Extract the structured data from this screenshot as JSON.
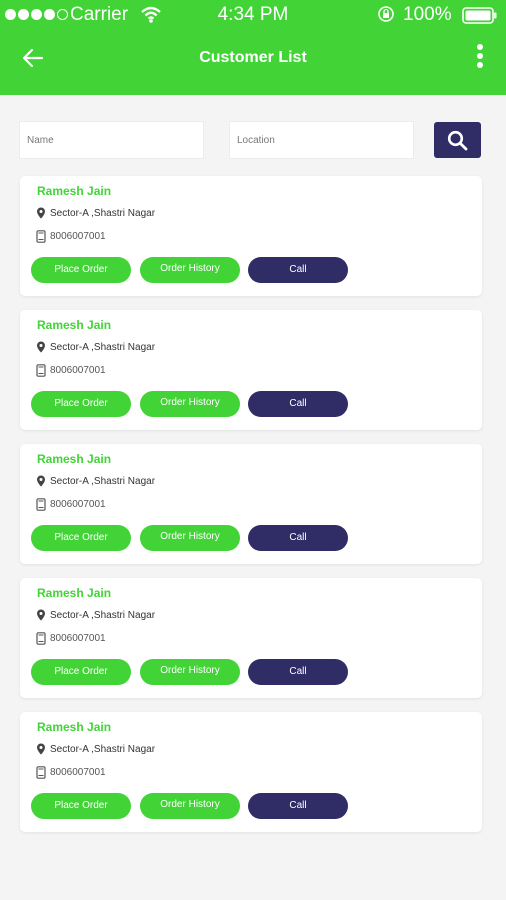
{
  "status_bar": {
    "carrier": "Carrier",
    "time": "4:34 PM",
    "battery": "100%"
  },
  "header": {
    "title": "Customer List"
  },
  "search": {
    "name_placeholder": "Name",
    "location_placeholder": "Location"
  },
  "customers": [
    {
      "name": "Ramesh Jain",
      "address": "Sector-A ,Shastri Nagar",
      "phone": "8006007001",
      "place_order": "Place Order",
      "order_history": "Order History",
      "call": "Call"
    },
    {
      "name": "Ramesh Jain",
      "address": "Sector-A ,Shastri Nagar",
      "phone": "8006007001",
      "place_order": "Place Order",
      "order_history": "Order History",
      "call": "Call"
    },
    {
      "name": "Ramesh Jain",
      "address": "Sector-A ,Shastri Nagar",
      "phone": "8006007001",
      "place_order": "Place Order",
      "order_history": "Order History",
      "call": "Call"
    },
    {
      "name": "Ramesh Jain",
      "address": "Sector-A ,Shastri Nagar",
      "phone": "8006007001",
      "place_order": "Place Order",
      "order_history": "Order History",
      "call": "Call"
    },
    {
      "name": "Ramesh Jain",
      "address": "Sector-A ,Shastri Nagar",
      "phone": "8006007001",
      "place_order": "Place Order",
      "order_history": "Order History",
      "call": "Call"
    }
  ],
  "colors": {
    "primary_green": "#42d337",
    "navy": "#2f2c66",
    "background": "#f4f4f4"
  },
  "icons": {
    "back": "arrow-left-icon",
    "more": "more-vertical-icon",
    "search": "search-icon",
    "location": "map-pin-icon",
    "phone": "phone-icon"
  }
}
